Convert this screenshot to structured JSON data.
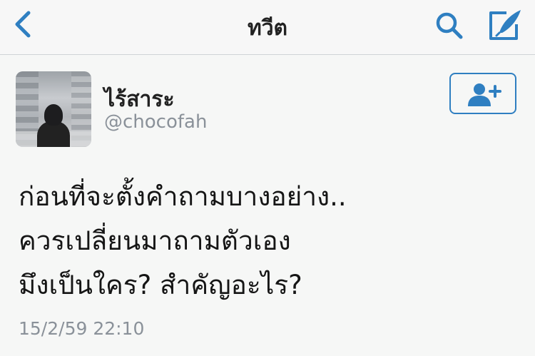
{
  "nav": {
    "title": "ทวีต",
    "back_icon": "chevron-left-icon",
    "search_icon": "search-icon",
    "compose_icon": "compose-icon"
  },
  "tweet": {
    "display_name": "ไร้สาระ",
    "handle": "@chocofah",
    "follow_icon": "add-user-icon",
    "text_lines": [
      "ก่อนที่จะตั้งคำถามบางอย่าง..",
      "ควรเปลี่ยนมาถามตัวเอง",
      "มึงเป็นใคร? สำคัญอะไร?"
    ],
    "timestamp": "15/2/59 22:10"
  },
  "colors": {
    "accent": "#2f7fc1",
    "secondary_text": "#8a9199",
    "background": "#f6f7f6"
  }
}
